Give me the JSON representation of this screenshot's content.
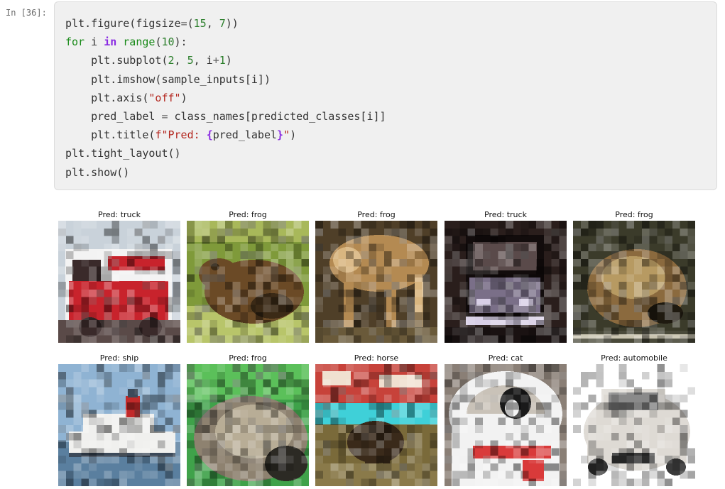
{
  "prompt": "In [36]:",
  "code_lines": [
    [
      [
        "plt.figure(figsize",
        "plain"
      ],
      [
        "=",
        "op"
      ],
      [
        "(",
        "plain"
      ],
      [
        "15",
        "num"
      ],
      [
        ", ",
        "plain"
      ],
      [
        "7",
        "num"
      ],
      [
        "))",
        "plain"
      ]
    ],
    [
      [
        "for",
        "kw"
      ],
      [
        " i ",
        "plain"
      ],
      [
        "in",
        "kw2"
      ],
      [
        " ",
        "plain"
      ],
      [
        "range",
        "kw"
      ],
      [
        "(",
        "plain"
      ],
      [
        "10",
        "num"
      ],
      [
        "):",
        "plain"
      ]
    ],
    [
      [
        "    plt.subplot(",
        "plain"
      ],
      [
        "2",
        "num"
      ],
      [
        ", ",
        "plain"
      ],
      [
        "5",
        "num"
      ],
      [
        ", i",
        "plain"
      ],
      [
        "+",
        "op"
      ],
      [
        "1",
        "num"
      ],
      [
        ")",
        "plain"
      ]
    ],
    [
      [
        "    plt.imshow(sample_inputs[i])",
        "plain"
      ]
    ],
    [
      [
        "    plt.axis(",
        "plain"
      ],
      [
        "\"off\"",
        "str"
      ],
      [
        ")",
        "plain"
      ]
    ],
    [
      [
        "    pred_label ",
        "plain"
      ],
      [
        "=",
        "op"
      ],
      [
        " class_names[predicted_classes[i]]",
        "plain"
      ]
    ],
    [
      [
        "    plt.title(",
        "plain"
      ],
      [
        "f\"Pred: ",
        "str"
      ],
      [
        "{",
        "kw2"
      ],
      [
        "pred_label",
        "plain"
      ],
      [
        "}",
        "kw2"
      ],
      [
        "\"",
        "str"
      ],
      [
        ")",
        "plain"
      ]
    ],
    [
      [
        "plt.tight_layout()",
        "plain"
      ]
    ],
    [
      [
        "plt.show()",
        "plain"
      ]
    ]
  ],
  "output": {
    "images": [
      {
        "title": "Pred: truck",
        "subject": "fire-truck",
        "palette": {
          "bg": "#c9d2da",
          "main": "#c8232c",
          "accent": "#f3f3f3",
          "dark": "#3a2a2a"
        }
      },
      {
        "title": "Pred: frog",
        "subject": "frog",
        "palette": {
          "bg": "#7f9a3a",
          "main": "#6b4a26",
          "accent": "#b8c56a",
          "dark": "#3b2a16"
        }
      },
      {
        "title": "Pred: frog",
        "subject": "deer",
        "palette": {
          "bg": "#4f3f28",
          "main": "#b48a52",
          "accent": "#d9b680",
          "dark": "#2e2418"
        }
      },
      {
        "title": "Pred: truck",
        "subject": "truck-night",
        "palette": {
          "bg": "#2a1e1c",
          "main": "#7a6f88",
          "accent": "#d8cfe6",
          "dark": "#120c0c"
        }
      },
      {
        "title": "Pred: frog",
        "subject": "toad",
        "palette": {
          "bg": "#3b3b2a",
          "main": "#8b6a3e",
          "accent": "#b79a62",
          "dark": "#1f1a10"
        }
      },
      {
        "title": "Pred: ship",
        "subject": "ship",
        "palette": {
          "bg": "#8fb3d3",
          "main": "#f0f0ee",
          "accent": "#c22a2a",
          "dark": "#3c4a5a"
        }
      },
      {
        "title": "Pred: frog",
        "subject": "toad-green",
        "palette": {
          "bg": "#3fa24a",
          "main": "#8e8270",
          "accent": "#b8ad96",
          "dark": "#2c2a24"
        }
      },
      {
        "title": "Pred: horse",
        "subject": "deer-sign",
        "palette": {
          "bg": "#7a6a3a",
          "main": "#c7423a",
          "accent": "#3fd0d8",
          "dark": "#3a2a1a"
        }
      },
      {
        "title": "Pred: cat",
        "subject": "cat-bucket",
        "palette": {
          "bg": "#8a7f76",
          "main": "#f2f2f2",
          "accent": "#d93a3a",
          "dark": "#1a1a1a"
        }
      },
      {
        "title": "Pred: automobile",
        "subject": "car",
        "palette": {
          "bg": "#ffffff",
          "main": "#dedad4",
          "accent": "#8a8a8a",
          "dark": "#3a3a3a"
        }
      }
    ]
  }
}
